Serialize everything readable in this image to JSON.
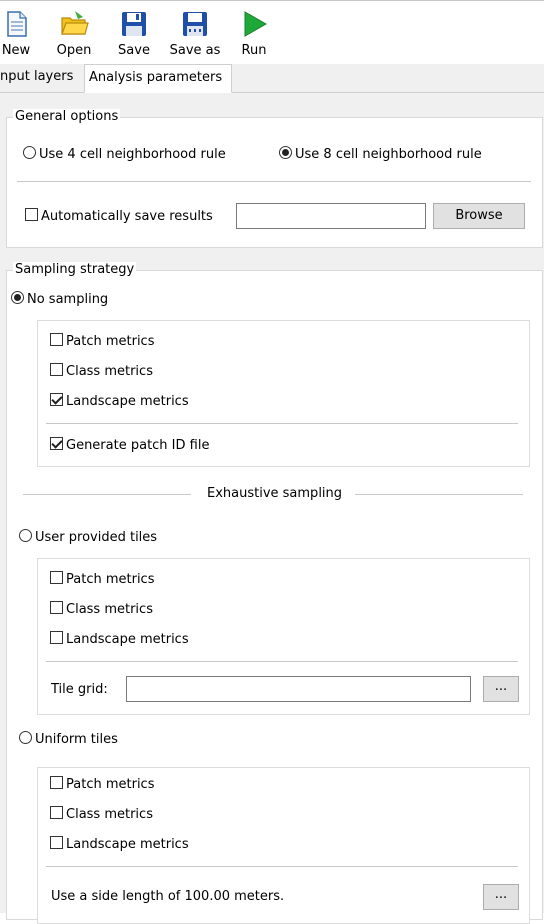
{
  "toolbar": {
    "new_label": "New",
    "open_label": "Open",
    "save_label": "Save",
    "save_as_label": "Save as",
    "run_label": "Run"
  },
  "tabs": [
    {
      "label": "Input layers",
      "visible_label": "nput layers",
      "active": false
    },
    {
      "label": "Analysis parameters",
      "active": true
    }
  ],
  "general_options": {
    "title": "General options",
    "rule_4": {
      "label": "Use 4 cell neighborhood rule",
      "selected": false
    },
    "rule_8": {
      "label": "Use 8 cell neighborhood rule",
      "selected": true
    },
    "auto_save": {
      "label": "Automatically save results",
      "checked": false
    },
    "save_path_value": "",
    "browse_label": "Browse"
  },
  "sampling": {
    "title": "Sampling strategy",
    "no_sampling": {
      "label": "No sampling",
      "selected": true,
      "patch": {
        "label": "Patch metrics",
        "checked": false
      },
      "class": {
        "label": "Class metrics",
        "checked": false
      },
      "landscape": {
        "label": "Landscape metrics",
        "checked": true
      },
      "patch_id": {
        "label": "Generate patch ID file",
        "checked": true
      }
    },
    "exhaustive_label": "Exhaustive sampling",
    "user_tiles": {
      "label": "User provided tiles",
      "selected": false,
      "patch": {
        "label": "Patch metrics",
        "checked": false
      },
      "class": {
        "label": "Class metrics",
        "checked": false
      },
      "landscape": {
        "label": "Landscape metrics",
        "checked": false
      },
      "tile_grid_label": "Tile grid:",
      "tile_grid_value": "",
      "browse_label": "..."
    },
    "uniform_tiles": {
      "label": "Uniform tiles",
      "selected": false,
      "patch": {
        "label": "Patch metrics",
        "checked": false
      },
      "class": {
        "label": "Class metrics",
        "checked": false
      },
      "landscape": {
        "label": "Landscape metrics",
        "checked": false
      },
      "side_length_text": "Use a side length of 100.00 meters.",
      "settings_label": "..."
    }
  },
  "colors": {
    "run_green": "#1fa83a",
    "open_yellow": "#f2c21b",
    "save_blue": "#1f4fa8"
  }
}
